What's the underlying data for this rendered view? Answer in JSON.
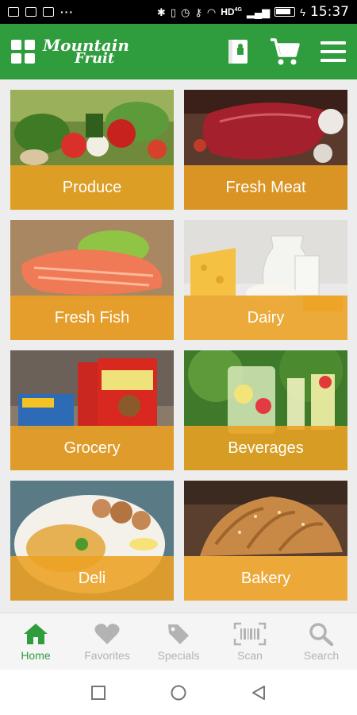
{
  "status_bar": {
    "time": "15:37",
    "network": "HD",
    "network_sup": "4G"
  },
  "header": {
    "logo_line1": "Mountain",
    "logo_line2": "Fruit"
  },
  "categories": [
    {
      "label": "Produce"
    },
    {
      "label": "Fresh Meat"
    },
    {
      "label": "Fresh Fish"
    },
    {
      "label": "Dairy"
    },
    {
      "label": "Grocery"
    },
    {
      "label": "Beverages"
    },
    {
      "label": "Deli"
    },
    {
      "label": "Bakery"
    }
  ],
  "bottom_nav": {
    "items": [
      {
        "label": "Home",
        "icon": "home-icon",
        "active": true
      },
      {
        "label": "Favorites",
        "icon": "heart-icon",
        "active": false
      },
      {
        "label": "Specials",
        "icon": "tag-icon",
        "active": false
      },
      {
        "label": "Scan",
        "icon": "barcode-scan-icon",
        "active": false
      },
      {
        "label": "Search",
        "icon": "magnifier-icon",
        "active": false
      }
    ]
  },
  "colors": {
    "brand_green": "#2f9d3d",
    "band_orange": "#eca122",
    "nav_inactive": "#b3b3b3"
  }
}
